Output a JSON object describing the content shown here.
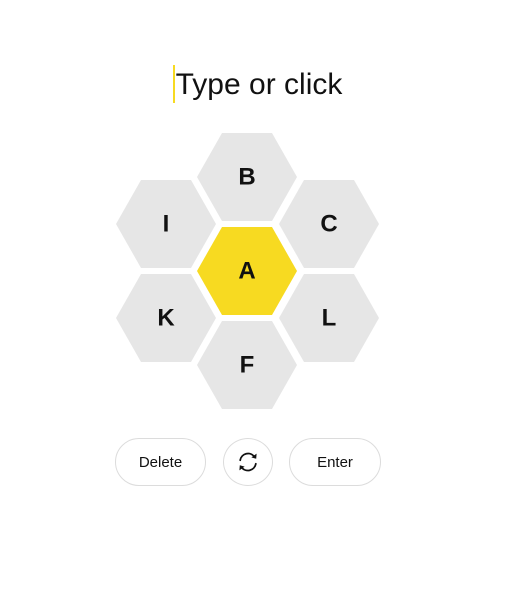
{
  "input": {
    "placeholder": "Type or click",
    "caret_color": "#f7da21"
  },
  "hive": {
    "center_letter": "A",
    "outer_letters": [
      "B",
      "C",
      "L",
      "F",
      "K",
      "I"
    ],
    "center_color": "#f7da21",
    "outer_color": "#e6e6e6"
  },
  "controls": {
    "delete_label": "Delete",
    "shuffle_icon": "shuffle-icon",
    "enter_label": "Enter"
  }
}
